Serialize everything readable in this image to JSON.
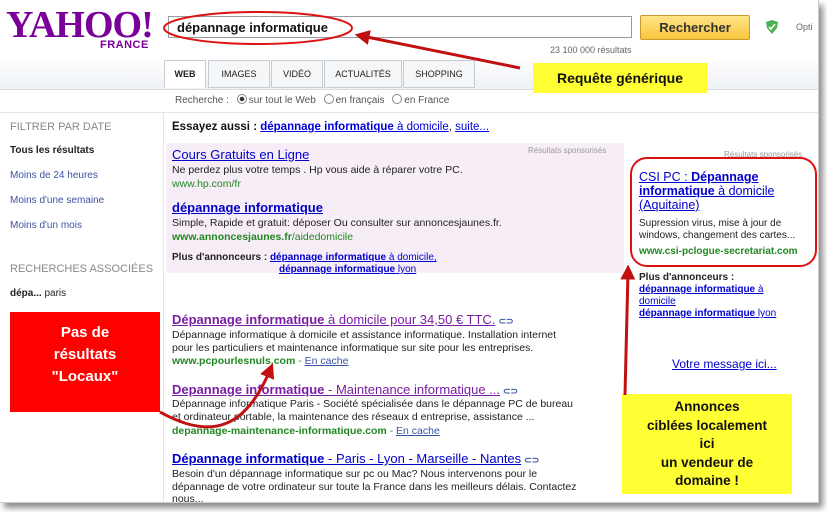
{
  "logo": {
    "main": "YAHOO!",
    "sub": "FRANCE"
  },
  "search": {
    "query": "dépannage informatique",
    "button": "Rechercher",
    "options_label": "Opti",
    "result_count": "23 100 000 résultats"
  },
  "tabs": [
    "WEB",
    "IMAGES",
    "VIDÉO",
    "ACTUALITÉS",
    "SHOPPING"
  ],
  "scope": {
    "label": "Recherche :",
    "options": [
      "sur tout le Web",
      "en français",
      "en France"
    ],
    "selected": 0
  },
  "sidebar": {
    "filter_heading": "FILTRER PAR DATE",
    "filters": [
      "Tous les résultats",
      "Moins de 24 heures",
      "Moins d'une semaine",
      "Moins d'un mois"
    ],
    "related_heading": "RECHERCHES ASSOCIÉES",
    "related_bold": "dépa...",
    "related_rest": "paris"
  },
  "try_also": {
    "label": "Essayez aussi :",
    "bold": "dépannage informatique",
    "rest": " à domicile",
    "suite": "suite..."
  },
  "sponsored_label": "Résultats sponsorisés",
  "sponsored": [
    {
      "title": "Cours Gratuits en Ligne",
      "desc": "Ne perdez plus votre temps . Hp vous aide à réparer votre PC.",
      "url": "www.hp.com/fr"
    },
    {
      "title": "dépannage informatique",
      "desc": "Simple, Rapide et gratuit: déposer Ou consulter sur annoncesjaunes.fr.",
      "url_bold": "www.annoncesjaunes.fr",
      "url_rest": "/aidedomicile"
    }
  ],
  "more_advertisers": {
    "label": "Plus d'annonceurs :",
    "link1_bold": "dépannage informatique",
    "link1_rest": " à domicile,",
    "link2_bold": "dépannage informatique",
    "link2_rest": " lyon"
  },
  "results": [
    {
      "title_bold": "Dépannage informatique",
      "title_rest": " à domicile pour 34,50 € TTC.",
      "desc": [
        "Dépannage informatique à domicile et assistance informatique. Installation internet",
        "pour les particuliers et maintenance informatique sur site pour les entreprises."
      ],
      "url": "www.pcpourlesnuls.com",
      "cache": "En cache"
    },
    {
      "title_bold": "Depannage informatique",
      "title_rest": " - Maintenance informatique ...",
      "desc": [
        "Dépannage informatique Paris - Société spécialisée dans le dépannage PC de bureau",
        "et ordinateur portable, la maintenance des réseaux d entreprise, assistance ..."
      ],
      "url": "depannage-maintenance-informatique.com",
      "cache": "En cache"
    },
    {
      "title_bold": "Dépannage informatique",
      "title_rest": " - Paris - Lyon - Marseille - Nantes",
      "desc": [
        "Besoin d'un dépannage informatique sur pc ou Mac? Nous intervenons pour le",
        "dépannage de votre ordinateur sur toute la France dans les meilleurs délais. Contactez",
        "nous..."
      ]
    }
  ],
  "right_ad": {
    "title_a": "CSI PC : ",
    "title_bold1": "Dépannage",
    "title_bold2": "informatique",
    "title_rest": " à domicile",
    "title_tail": "(Aquitaine)",
    "desc": [
      "Supression virus, mise à jour de",
      "windows, changement des cartes..."
    ],
    "url": "www.csi-pclogue-secretariat.com",
    "more_label": "Plus d'annonceurs :",
    "more_link1_bold": "dépannage informatique",
    "more_link1_rest": " à",
    "more_link1_tail": "domicile",
    "more_link2_bold": "dépannage informatique",
    "more_link2_rest": " lyon",
    "votre": "Votre message ici..."
  },
  "annotations": {
    "generic_query": "Requête générique",
    "no_local": [
      "Pas de",
      "résultats",
      "\"Locaux\""
    ],
    "targeted": [
      "Annonces",
      "ciblées localement",
      "ici",
      "un vendeur de",
      "domaine !"
    ]
  },
  "colors": {
    "yahoo_purple": "#7b0099",
    "link_blue": "#0000cc",
    "url_green": "#228822",
    "highlight_yellow": "#ffff33",
    "annotation_red": "#ff0000",
    "arrow_red": "#c01010"
  }
}
